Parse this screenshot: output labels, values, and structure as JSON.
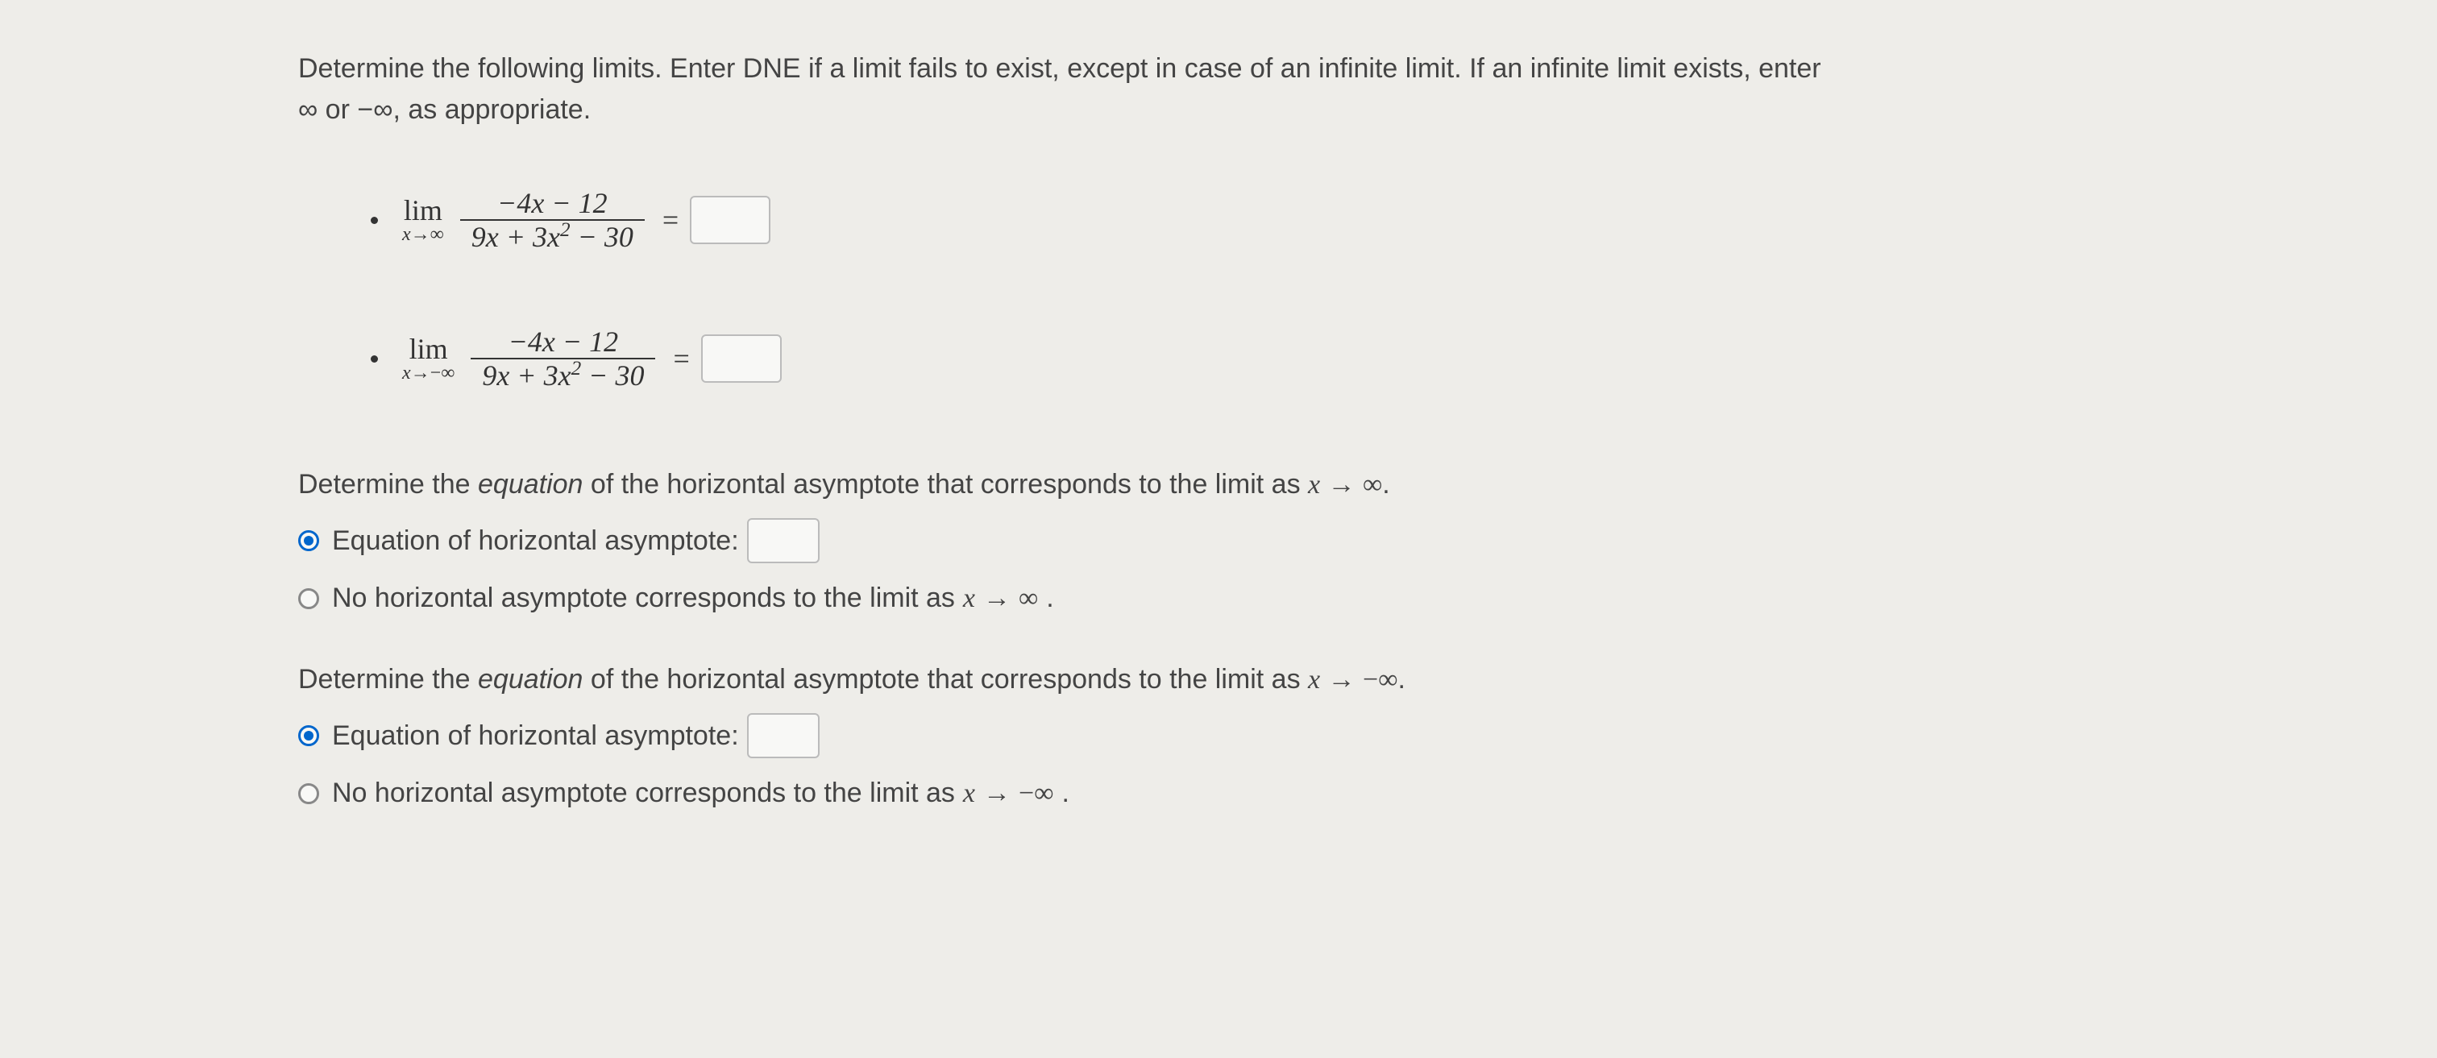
{
  "instructions": "Determine the following limits. Enter DNE if a limit fails to exist, except in case of an infinite limit. If an infinite limit exists, enter ∞ or −∞, as appropriate.",
  "limits": [
    {
      "lim_text": "lim",
      "approach_var": "x",
      "approach_arrow": "→",
      "approach_target": "∞",
      "numerator": "−4x − 12",
      "denom_a": "9x + 3x",
      "denom_exp": "2",
      "denom_b": " − 30",
      "equals": "="
    },
    {
      "lim_text": "lim",
      "approach_var": "x",
      "approach_arrow": "→",
      "approach_target": "−∞",
      "numerator": "−4x − 12",
      "denom_a": "9x + 3x",
      "denom_exp": "2",
      "denom_b": " − 30",
      "equals": "="
    }
  ],
  "q1": {
    "prompt_a": "Determine the ",
    "prompt_em": "equation",
    "prompt_b": " of the horizontal asymptote that corresponds to the limit as ",
    "math_x": "x",
    "arrow": " → ",
    "target": "∞",
    "period": ".",
    "option1_label": "Equation of horizontal asymptote:",
    "option2_label_a": "No horizontal asymptote corresponds to the limit as ",
    "option2_math_x": "x",
    "option2_arrow": " → ",
    "option2_target": "∞",
    "option2_period": "."
  },
  "q2": {
    "prompt_a": "Determine the ",
    "prompt_em": "equation",
    "prompt_b": " of the horizontal asymptote that corresponds to the limit as ",
    "math_x": "x",
    "arrow": " → ",
    "target": "−∞",
    "period": ".",
    "option1_label": "Equation of horizontal asymptote:",
    "option2_label_a": "No horizontal asymptote corresponds to the limit as ",
    "option2_math_x": "x",
    "option2_arrow": " → ",
    "option2_target": "−∞",
    "option2_period": "."
  }
}
